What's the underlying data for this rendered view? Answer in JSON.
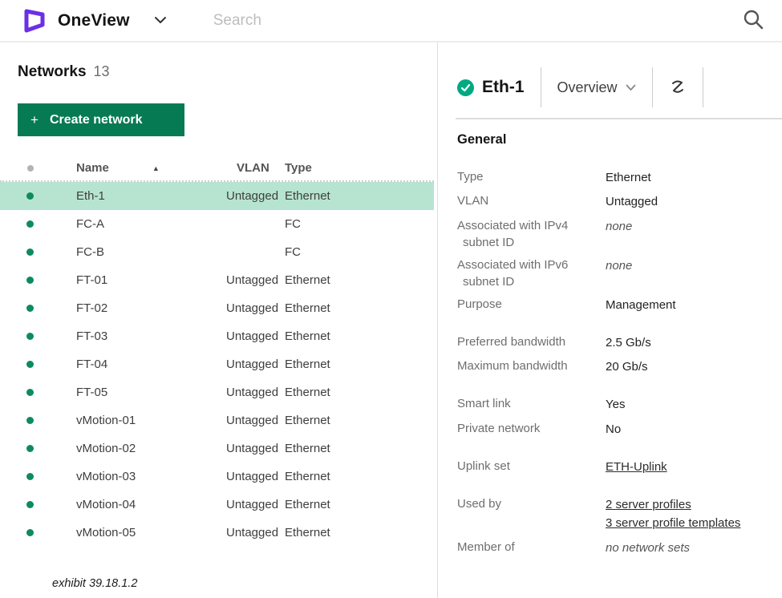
{
  "topbar": {
    "app_name": "OneView",
    "search_placeholder": "Search"
  },
  "left_panel": {
    "title": "Networks",
    "count": "13",
    "create_button": {
      "plus": "+",
      "label": "Create network"
    },
    "table": {
      "columns": {
        "name": "Name",
        "vlan": "VLAN",
        "type": "Type",
        "sort_indicator": "▲"
      },
      "rows": [
        {
          "name": "Eth-1",
          "vlan": "Untagged",
          "type": "Ethernet",
          "selected": true
        },
        {
          "name": "FC-A",
          "vlan": "",
          "type": "FC",
          "selected": false
        },
        {
          "name": "FC-B",
          "vlan": "",
          "type": "FC",
          "selected": false
        },
        {
          "name": "FT-01",
          "vlan": "Untagged",
          "type": "Ethernet",
          "selected": false
        },
        {
          "name": "FT-02",
          "vlan": "Untagged",
          "type": "Ethernet",
          "selected": false
        },
        {
          "name": "FT-03",
          "vlan": "Untagged",
          "type": "Ethernet",
          "selected": false
        },
        {
          "name": "FT-04",
          "vlan": "Untagged",
          "type": "Ethernet",
          "selected": false
        },
        {
          "name": "FT-05",
          "vlan": "Untagged",
          "type": "Ethernet",
          "selected": false
        },
        {
          "name": "vMotion-01",
          "vlan": "Untagged",
          "type": "Ethernet",
          "selected": false
        },
        {
          "name": "vMotion-02",
          "vlan": "Untagged",
          "type": "Ethernet",
          "selected": false
        },
        {
          "name": "vMotion-03",
          "vlan": "Untagged",
          "type": "Ethernet",
          "selected": false
        },
        {
          "name": "vMotion-04",
          "vlan": "Untagged",
          "type": "Ethernet",
          "selected": false
        },
        {
          "name": "vMotion-05",
          "vlan": "Untagged",
          "type": "Ethernet",
          "selected": false
        }
      ]
    },
    "exhibit": "exhibit 39.18.1.2"
  },
  "right_panel": {
    "resource_name": "Eth-1",
    "view_selector": "Overview",
    "section_title": "General",
    "groups": [
      {
        "rows": [
          {
            "label": [
              "Type"
            ],
            "values": [
              {
                "t": "Ethernet",
                "s": "normal"
              }
            ]
          },
          {
            "label": [
              "VLAN"
            ],
            "values": [
              {
                "t": "Untagged",
                "s": "normal"
              }
            ]
          },
          {
            "label": [
              "Associated with IPv4",
              "subnet ID"
            ],
            "values": [
              {
                "t": "none",
                "s": "italic"
              }
            ]
          },
          {
            "label": [
              "Associated with IPv6",
              "subnet ID"
            ],
            "values": [
              {
                "t": "none",
                "s": "italic"
              }
            ]
          },
          {
            "label": [
              "Purpose"
            ],
            "values": [
              {
                "t": "Management",
                "s": "normal"
              }
            ]
          }
        ]
      },
      {
        "rows": [
          {
            "label": [
              "Preferred bandwidth"
            ],
            "values": [
              {
                "t": "2.5 Gb/s",
                "s": "normal"
              }
            ]
          },
          {
            "label": [
              "Maximum bandwidth"
            ],
            "values": [
              {
                "t": "20 Gb/s",
                "s": "normal"
              }
            ]
          }
        ]
      },
      {
        "rows": [
          {
            "label": [
              "Smart link"
            ],
            "values": [
              {
                "t": "Yes",
                "s": "normal"
              }
            ]
          },
          {
            "label": [
              "Private network"
            ],
            "values": [
              {
                "t": "No",
                "s": "normal"
              }
            ]
          }
        ]
      },
      {
        "rows": [
          {
            "label": [
              "Uplink set"
            ],
            "values": [
              {
                "t": "ETH-Uplink",
                "s": "link"
              }
            ]
          }
        ]
      },
      {
        "rows": [
          {
            "label": [
              "Used by"
            ],
            "values": [
              {
                "t": "2 server profiles",
                "s": "link"
              },
              {
                "t": "3 server profile templates",
                "s": "link"
              }
            ]
          },
          {
            "label": [
              "Member of"
            ],
            "values": [
              {
                "t": "no network sets",
                "s": "italic"
              }
            ]
          }
        ]
      }
    ]
  },
  "colors": {
    "brand_purple": "#6b30e6",
    "status_green": "#01a982",
    "row_dot_green": "#0d8a5f",
    "button_green": "#067a53",
    "selected_row_bg": "#b7e4d1"
  }
}
